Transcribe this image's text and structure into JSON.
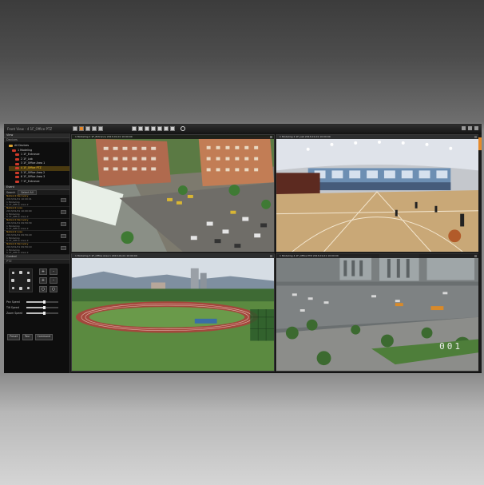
{
  "app": {
    "title": "Front View - 4 1F_Office PTZ",
    "accent_color": "#e6882c"
  },
  "sidebar": {
    "view_header": "View",
    "devices_subheader": "Devices",
    "tree": [
      {
        "label": "All Devices",
        "level": 0
      },
      {
        "label": "1 Modeling",
        "level": 1
      },
      {
        "label": "1 1F_Entrance",
        "level": 2
      },
      {
        "label": "2 1F_Lab",
        "level": 2
      },
      {
        "label": "3 1F_Office Area 1",
        "level": 2
      },
      {
        "label": "4 1F_Office PTZ",
        "level": 2,
        "selected": true
      },
      {
        "label": "5 1F_Office Area 2",
        "level": 2
      },
      {
        "label": "6 1F_Office Area 3",
        "level": 2
      },
      {
        "label": "7 1F_Entrance",
        "level": 2
      }
    ],
    "event_header": "Event",
    "event_bar": {
      "label": "Search",
      "select": "Select All"
    },
    "events": [
      {
        "title": "Network Recovery",
        "lines": [
          "2013/01/01 10:00:01",
          "1 Modeling",
          "5 1F_Office Area 2"
        ]
      },
      {
        "title": "Network Loss",
        "lines": [
          "2013/01/01 10:00:00",
          "1 Modeling",
          "5 1F_Office Area 2"
        ]
      },
      {
        "title": "Network Recovery",
        "lines": [
          "2013/01/01 09:59:30",
          "1 Modeling",
          "5 1F_Office Area 2"
        ]
      },
      {
        "title": "Network Loss",
        "lines": [
          "2013/01/01 09:59:29",
          "1 Modeling",
          "5 1F_Office Area 2"
        ]
      },
      {
        "title": "Network Recovery",
        "lines": [
          "2013/01/01 09:59:10",
          "1 Modeling",
          "5 1F_Office Area 2"
        ]
      }
    ],
    "control_header": "Control",
    "ptz_subheader": "PTZ",
    "ptz_buttons": [
      "+",
      "-",
      "+",
      "-",
      "○",
      "○"
    ],
    "sliders": [
      {
        "label": "Pan Speed",
        "value": 0.55
      },
      {
        "label": "Tilt Speed",
        "value": 0.55
      },
      {
        "label": "Zoom Speed",
        "value": 0.55
      }
    ],
    "bottom_buttons": [
      "Preset",
      "Tour",
      "Command"
    ]
  },
  "cameras": [
    {
      "title": "1 Modeling 1 1F_Entrance  2013-01-01 10:00:00"
    },
    {
      "title": "1 Modeling 2 1F_Lab  2013-01-01 10:00:00"
    },
    {
      "title": "1 Modeling 3 1F_Office Area 1  2013-01-01 10:00:00"
    },
    {
      "title": "1 Modeling 4 1F_Office PTZ  2013-01-01 10:00:00",
      "overlay": "001"
    }
  ]
}
